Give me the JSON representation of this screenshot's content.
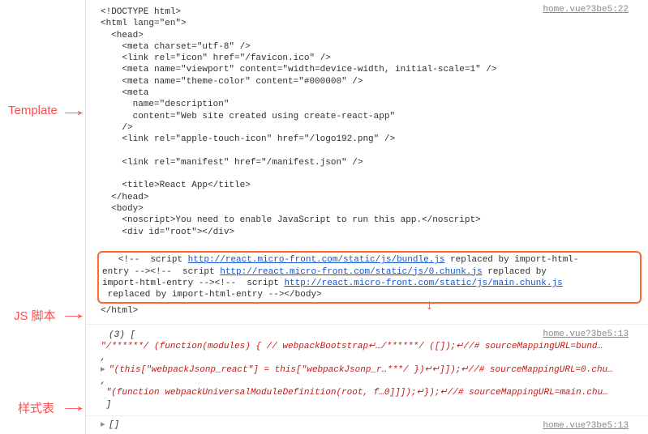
{
  "labels": {
    "template": "Template",
    "js": "JS 脚本",
    "css": "样式表"
  },
  "src_links": {
    "template": "home.vue?3be5:22",
    "js": "home.vue?3be5:13",
    "css": "home.vue?3be5:13"
  },
  "html": {
    "l1": "<!DOCTYPE html>",
    "l2": "<html lang=\"en\">",
    "l3": "  <head>",
    "l4": "    <meta charset=\"utf-8\" />",
    "l5": "    <link rel=\"icon\" href=\"/favicon.ico\" />",
    "l6": "    <meta name=\"viewport\" content=\"width=device-width, initial-scale=1\" />",
    "l7a": "    <meta name=\"theme-color\" content=\"",
    "l7b": "#000000",
    "l7c": "\" />",
    "l8": "    <meta",
    "l9": "      name=\"description\"",
    "l10": "      content=\"Web site created using create-react-app\"",
    "l11": "    />",
    "l12": "    <link rel=\"apple-touch-icon\" href=\"/logo192.png\" />",
    "l13": "    ",
    "l14": "    <link rel=\"manifest\" href=\"/manifest.json\" />",
    "l15": "    ",
    "l16": "    <title>React App</title>",
    "l17": "  </head>",
    "l18": "  <body>",
    "l19": "    <noscript>You need to enable JavaScript to run this app.</noscript>",
    "l20": "    <div id=\"root\"></div>",
    "l21": "    "
  },
  "scripts": {
    "s1a": "   <!--  script ",
    "s1url": "http://react.micro-front.com/static/js/bundle.js",
    "s1b": " replaced by import-html-",
    "s2a": "entry --><!--  script ",
    "s2url": "http://react.micro-front.com/static/js/0.chunk.js",
    "s2b": " replaced by ",
    "s3a": "import-html-entry --><!--  script ",
    "s3url": "http://react.micro-front.com/static/js/main.chunk.js",
    "s4": " replaced by import-html-entry --></body>",
    "close": "</html>"
  },
  "js": {
    "count": "(3) [",
    "line1": "\"/******/ (function(modules) { // webpackBootstrap↵…/******/ ([]);↵//# sourceMappingURL=bund…",
    "comma": ",",
    "line2": "\"(this[\"webpackJsonp_react\"] = this[\"webpackJsonp_r…***/ })↵↵]]);↵//# sourceMappingURL=0.chu…",
    "line3": "\"(function webpackUniversalModuleDefinition(root, f…0]]]);↵});↵//# sourceMappingURL=main.chu…",
    "end": "]"
  },
  "css": {
    "arr": "[]"
  }
}
